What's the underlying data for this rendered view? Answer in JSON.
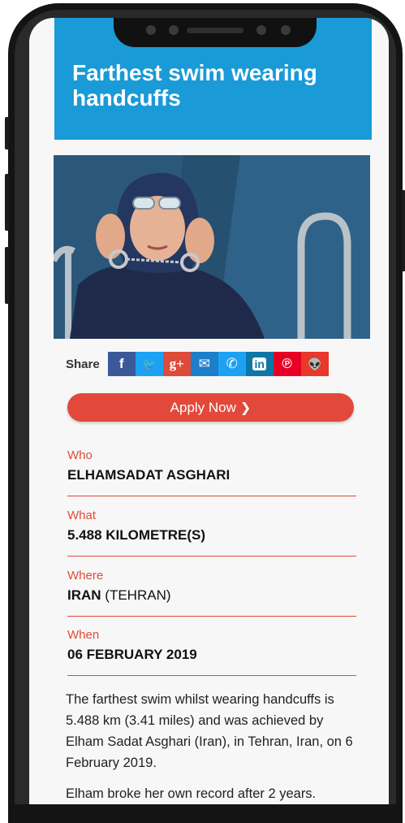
{
  "page": {
    "title": "Farthest swim wearing handcuffs"
  },
  "share": {
    "label": "Share",
    "buttons": [
      {
        "name": "facebook",
        "glyph": "f",
        "color": "#3b5998"
      },
      {
        "name": "twitter",
        "glyph": "🐦",
        "color": "#1da1f2"
      },
      {
        "name": "google-plus",
        "glyph": "g+",
        "color": "#dd4b39"
      },
      {
        "name": "email",
        "glyph": "✉",
        "color": "#1d7ec9"
      },
      {
        "name": "whatsapp",
        "glyph": "✆",
        "color": "#1da1f2"
      },
      {
        "name": "linkedin",
        "glyph": "in",
        "color": "#0e76a8"
      },
      {
        "name": "pinterest",
        "glyph": "℗",
        "color": "#e60023"
      },
      {
        "name": "reddit",
        "glyph": "👽",
        "color": "#e8372b"
      }
    ]
  },
  "apply": {
    "label": "Apply Now",
    "chevron": "❯"
  },
  "record": {
    "who": {
      "label": "Who",
      "value": "ELHAMSADAT ASGHARI"
    },
    "what": {
      "label": "What",
      "value": "5.488 KILOMETRE(S)"
    },
    "where": {
      "label": "Where",
      "value": "IRAN",
      "value_extra": "(TEHRAN)"
    },
    "when": {
      "label": "When",
      "value": "06 FEBRUARY 2019"
    }
  },
  "body": {
    "paragraph1": "The farthest swim whilst wearing handcuffs is 5.488 km (3.41 miles) and was achieved by Elham Sadat Asghari (Iran), in Tehran, Iran, on 6 February 2019.",
    "paragraph2": "Elham broke her own record after 2 years."
  },
  "colors": {
    "hero": "#1a9ad6",
    "accent": "#e24a37",
    "apply": "#e2493b"
  }
}
